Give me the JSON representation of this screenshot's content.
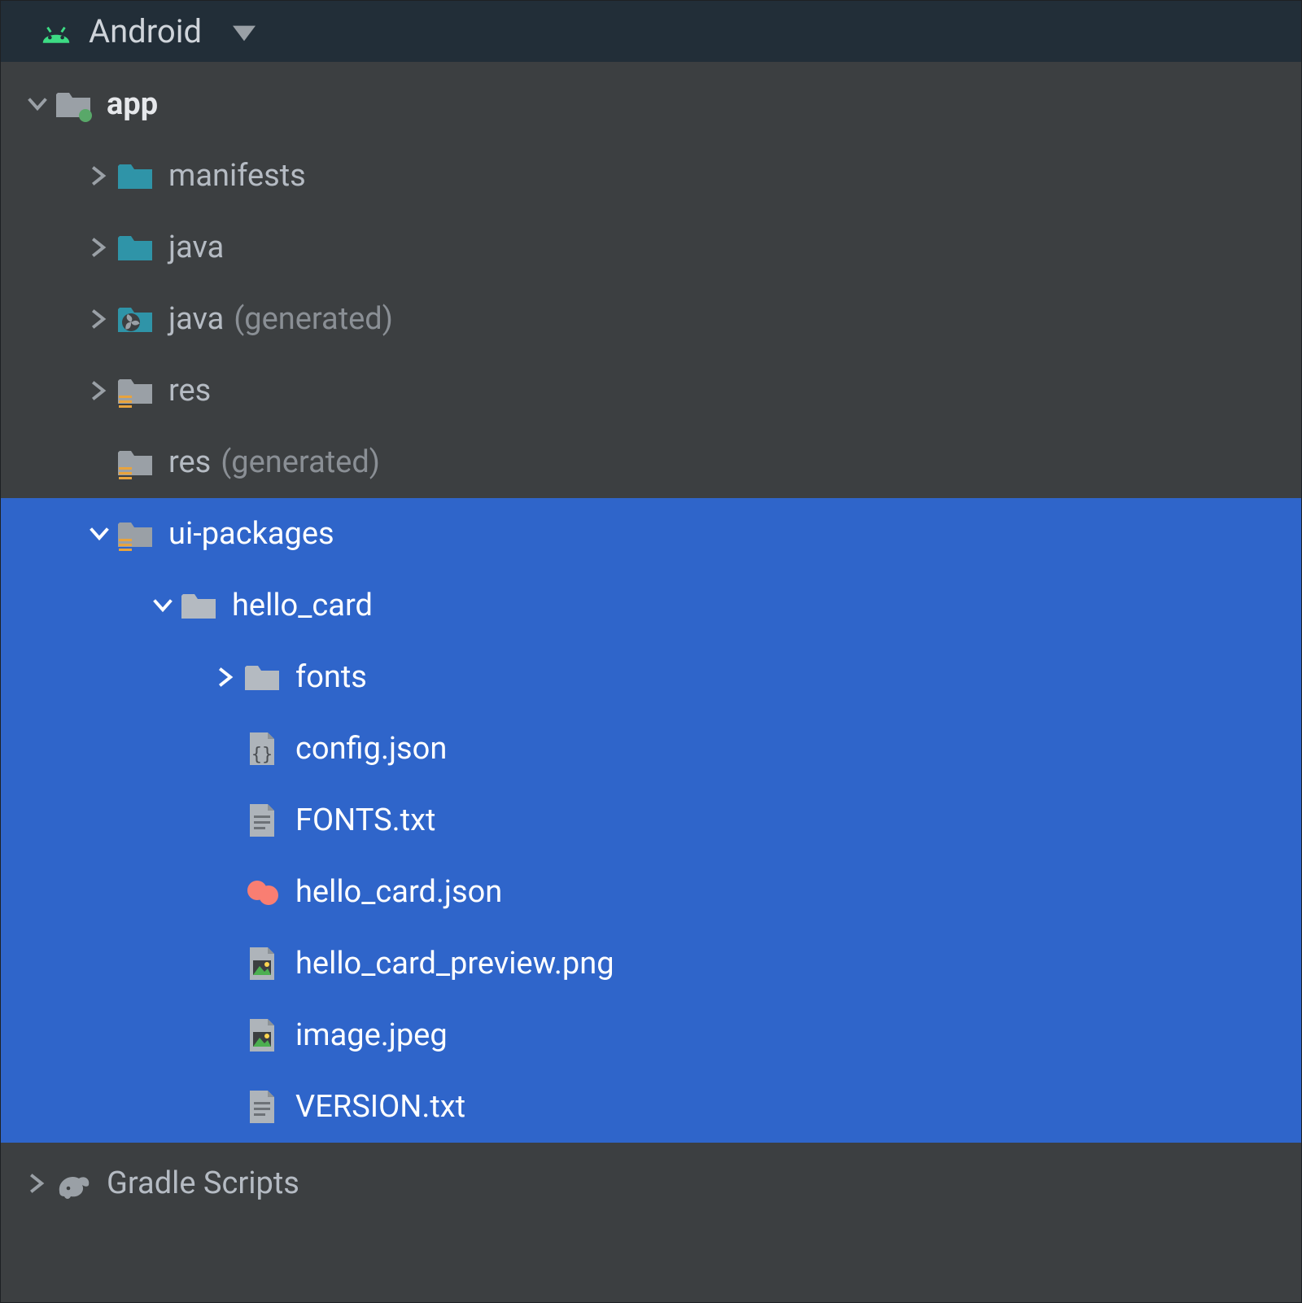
{
  "header": {
    "title": "Android"
  },
  "tree": {
    "app": {
      "label": "app",
      "children": {
        "manifests": {
          "label": "manifests"
        },
        "java": {
          "label": "java"
        },
        "java_generated": {
          "label": "java",
          "suffix": "(generated)"
        },
        "res": {
          "label": "res"
        },
        "res_generated": {
          "label": "res",
          "suffix": "(generated)"
        },
        "ui_packages": {
          "label": "ui-packages",
          "children": {
            "hello_card": {
              "label": "hello_card",
              "children": {
                "fonts": {
                  "label": "fonts"
                },
                "config": {
                  "label": "config.json"
                },
                "fontstx": {
                  "label": "FONTS.txt"
                },
                "hcjson": {
                  "label": "hello_card.json"
                },
                "preview": {
                  "label": "hello_card_preview.png"
                },
                "image": {
                  "label": "image.jpeg"
                },
                "version": {
                  "label": "VERSION.txt"
                }
              }
            }
          }
        }
      }
    },
    "gradle": {
      "label": "Gradle Scripts"
    }
  }
}
